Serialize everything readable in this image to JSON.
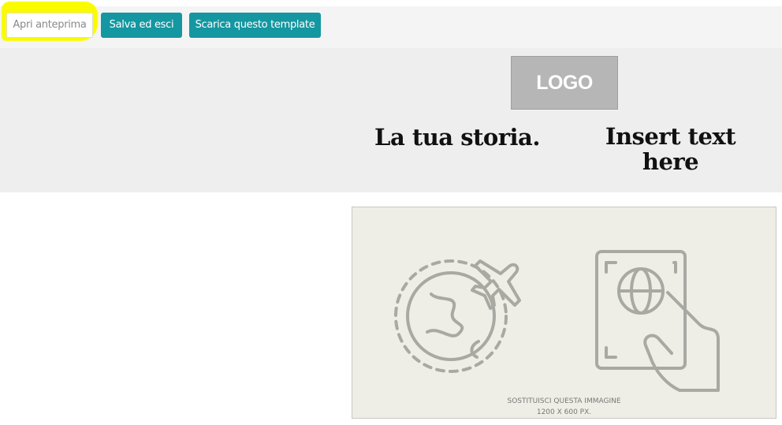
{
  "toolbar": {
    "preview_label": "Apri anteprima",
    "save_label": "Salva ed esci",
    "download_label": "Scarica questo template",
    "accent_color": "#1497a1",
    "highlight_color": "#fbfb00"
  },
  "header": {
    "logo_text": "LOGO",
    "story_text": "La tua storia.",
    "insert_line1": "Insert text",
    "insert_line2": "here"
  },
  "image_placeholder": {
    "caption_line1": "SOSTITUISCI QUESTA IMMAGINE",
    "caption_line2": "1200 X 600 PX.",
    "icons": [
      "globe-airplane-icon",
      "passport-hand-icon"
    ]
  }
}
